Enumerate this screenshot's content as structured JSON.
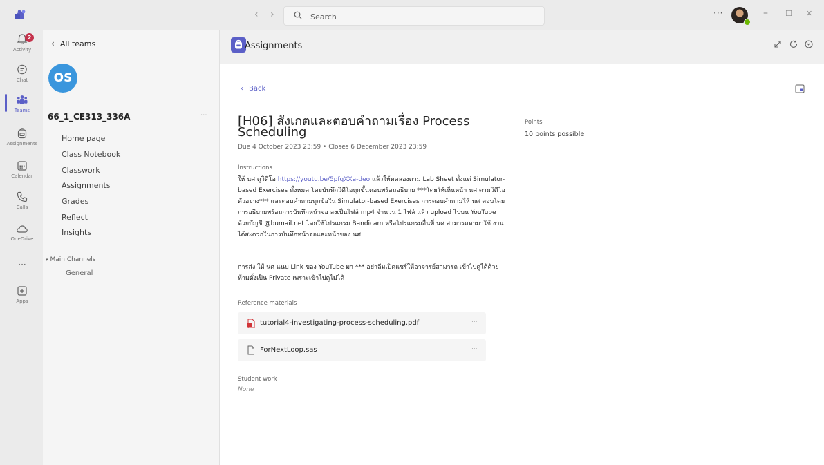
{
  "search": {
    "placeholder": "Search"
  },
  "topbar": {
    "more": "···",
    "minimize": "–",
    "maximize": "☐",
    "close": "✕"
  },
  "rail": [
    {
      "label": "Activity",
      "badge": "2"
    },
    {
      "label": "Chat"
    },
    {
      "label": "Teams",
      "active": true
    },
    {
      "label": "Assignments"
    },
    {
      "label": "Calendar"
    },
    {
      "label": "Calls"
    },
    {
      "label": "OneDrive"
    },
    {
      "label": "···"
    },
    {
      "label": "Apps"
    }
  ],
  "team_panel": {
    "all_teams": "All teams",
    "avatar_initials": "OS",
    "team_name": "66_1_CE313_336A",
    "more": "···",
    "nav": [
      "Home page",
      "Class Notebook",
      "Classwork",
      "Assignments",
      "Grades",
      "Reflect",
      "Insights"
    ],
    "main_channels": "Main Channels",
    "general": "General"
  },
  "app": {
    "title": "Assignments"
  },
  "assignment": {
    "back": "Back",
    "title": "[H06] สังเกตและตอบคำถามเรื่อง Process Scheduling",
    "due": "Due 4 October 2023 23:59 • Closes 6 December 2023 23:59",
    "points_label": "Points",
    "points_value": "10 points possible",
    "instructions_label": "Instructions",
    "instr_prefix": "ให้ นศ ดูวิดีโอ ",
    "instr_link": "https://youtu.be/5pfqXXa-deo",
    "instr_rest": " แล้วให้ทดลองตาม Lab Sheet ตั้งแต่ Simulator-based Exercises ทั้งหมด โดยบันทึกวิดีโอทุกขั้นตอนพร้อมอธิบาย ***โดยให้เห็นหน้า นศ ตามวิดีโอตัวอย่าง*** และตอบคำถามทุกข้อใน Simulator-based Exercises การตอบคำถามให้ นศ ตอบโดยการอธิบายพร้อมการบันทึกหน้าจอ ลงเป็นไฟล์ mp4 จำนวน 1 ไฟล์ แล้ว upload ไปบน YouTube ด้วยบัญชี @bumail.net โดยใช้โปรแกรม Bandicam หรือโปรแกรมอื่นที่ นศ สามารถหามาใช้ งานได้สะดวกในการบันทึกหน้าจอและหน้าของ นศ",
    "instr_para2": "การส่ง ให้ นศ แนบ Link ของ YouTube มา *** อย่าลืมเปิดแชร์ให้อาจารย์สามารถ เข้าไปดูได้ด้วย ห้ามตั้งเป็น Private เพราะเข้าไปดูไม่ได้",
    "reference_label": "Reference materials",
    "attachments": [
      {
        "name": "tutorial4-investigating-process-scheduling.pdf",
        "icon": "pdf-icon",
        "more": "···"
      },
      {
        "name": "ForNextLoop.sas",
        "icon": "file-icon",
        "more": "···"
      }
    ],
    "student_work_label": "Student work",
    "student_work_value": "None"
  },
  "colors": {
    "accent": "#5b5fc7",
    "team_avatar": "#3a96dd",
    "badge": "#c4314b",
    "pdf": "#d13438"
  }
}
